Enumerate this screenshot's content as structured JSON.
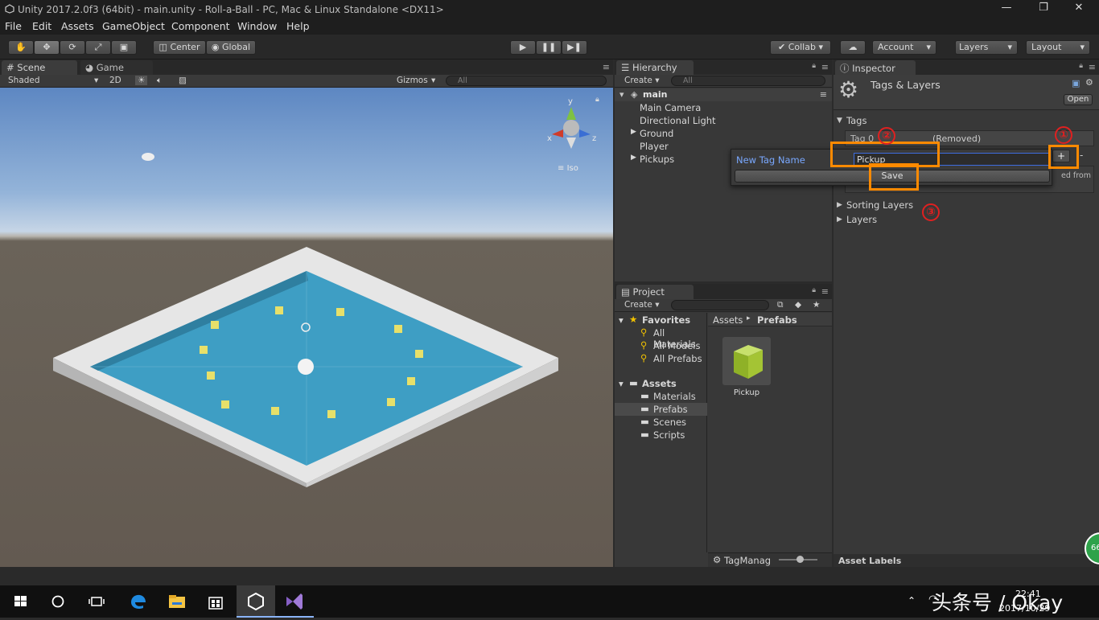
{
  "window": {
    "title": "Unity 2017.2.0f3 (64bit) - main.unity - Roll-a-Ball - PC, Mac & Linux Standalone <DX11>",
    "minimize": "—",
    "restore": "❐",
    "close": "✕"
  },
  "menu": [
    "File",
    "Edit",
    "Assets",
    "GameObject",
    "Component",
    "Window",
    "Help"
  ],
  "toolbar": {
    "center": "Center",
    "global": "Global",
    "collab": "Collab ▾",
    "account": "Account",
    "layers": "Layers",
    "layout": "Layout"
  },
  "scene": {
    "tab_scene": "Scene",
    "tab_game": "Game",
    "shaded": "Shaded",
    "two_d": "2D",
    "gizmos": "Gizmos",
    "search_placeholder": "All",
    "iso": "Iso",
    "axis_x": "x",
    "axis_y": "y",
    "axis_z": "z"
  },
  "hierarchy": {
    "tab": "Hierarchy",
    "create": "Create",
    "search_placeholder": "All",
    "scene_name": "main",
    "items": [
      "Main Camera",
      "Directional Light",
      "Ground",
      "Player",
      "Pickups"
    ]
  },
  "project": {
    "tab": "Project",
    "create": "Create",
    "favorites": "Favorites",
    "fav_items": [
      "All Materials",
      "All Models",
      "All Prefabs"
    ],
    "assets": "Assets",
    "asset_folders": [
      "Materials",
      "Prefabs",
      "Scenes",
      "Scripts"
    ],
    "breadcrumb_root": "Assets",
    "breadcrumb_sep": "▸",
    "breadcrumb_leaf": "Prefabs",
    "prefab_name": "Pickup",
    "footer": "TagManag"
  },
  "inspector": {
    "tab": "Inspector",
    "title": "Tags & Layers",
    "open": "Open",
    "tags_label": "Tags",
    "tag0": "Tag 0",
    "tag0_value": "(Removed)",
    "plus": "+",
    "minus": "-",
    "removed_hint": "ed from",
    "sorting_layers": "Sorting Layers",
    "layers": "Layers",
    "asset_labels": "Asset Labels"
  },
  "popup": {
    "label": "New Tag Name",
    "value": "Pickup",
    "save": "Save"
  },
  "annotations": [
    "①",
    "②",
    "③"
  ],
  "taskbar": {
    "time": "22:41",
    "date": "2017/10/29",
    "watermark": "头条号 / Okay",
    "badge": "66"
  }
}
